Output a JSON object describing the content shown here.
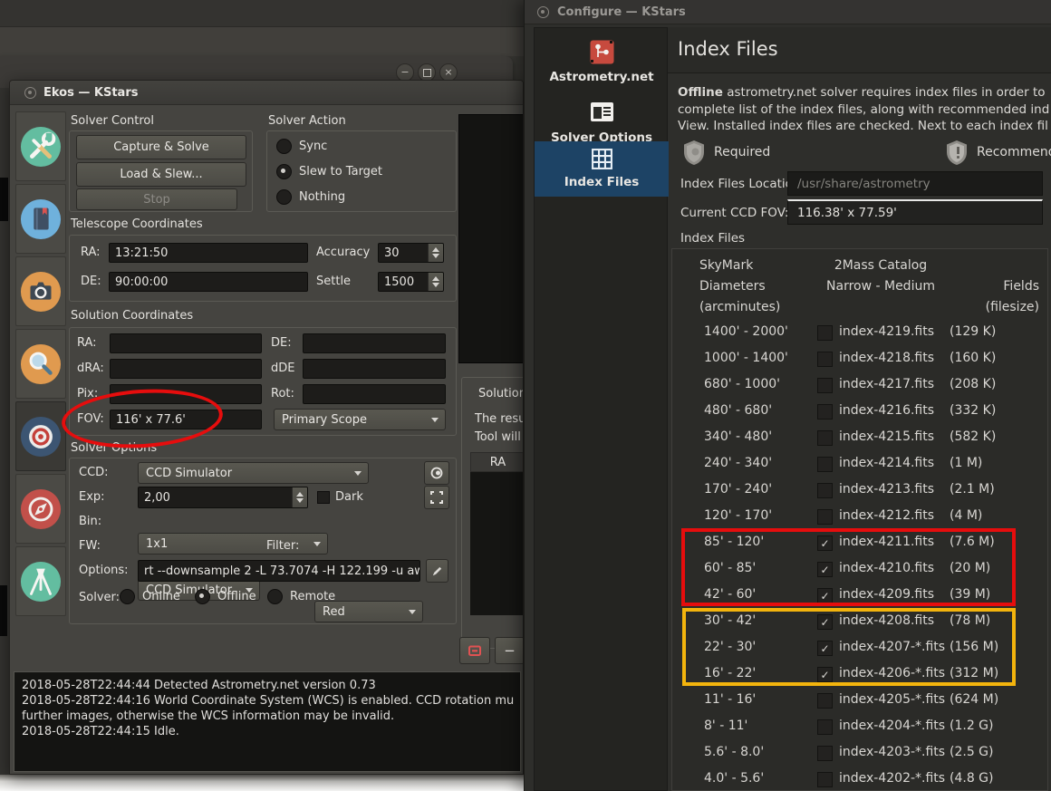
{
  "glyphs": {
    "minimize": "−",
    "close": "×",
    "minus": "−",
    "check": "✓"
  },
  "annotations": {
    "red": "#e60d0d",
    "yellow": "#f3b40d"
  },
  "ekos": {
    "window_title": "Ekos — KStars",
    "modules": [
      "setup-icon",
      "scheduler-icon",
      "capture-icon",
      "focus-icon",
      "align-target-icon",
      "guide-compass-icon",
      "mount-tripod-icon"
    ],
    "solver_control": {
      "title": "Solver Control",
      "capture_solve": "Capture & Solve",
      "load_slew": "Load & Slew...",
      "stop": "Stop"
    },
    "solver_action": {
      "title": "Solver Action",
      "options": [
        {
          "label": "Sync",
          "selected": false
        },
        {
          "label": "Slew to Target",
          "selected": true
        },
        {
          "label": "Nothing",
          "selected": false
        }
      ]
    },
    "telescope_coordinates": {
      "title": "Telescope Coordinates",
      "ra_label": "RA:",
      "ra_value": "13:21:50",
      "de_label": "DE:",
      "de_value": "90:00:00",
      "accuracy_label": "Accuracy",
      "accuracy_value": "30",
      "settle_label": "Settle",
      "settle_value": "1500"
    },
    "solution_coordinates": {
      "title": "Solution Coordinates",
      "ra_label": "RA:",
      "de_label": "DE:",
      "dra_label": "dRA:",
      "dde_label": "dDE",
      "pix_label": "Pix:",
      "rot_label": "Rot:",
      "fov_label": "FOV:",
      "fov_value": "116' x 77.6'",
      "scope_select": "Primary Scope"
    },
    "solver_options_group": {
      "title": "Solver Options",
      "ccd_label": "CCD:",
      "ccd_value": "CCD Simulator",
      "exp_label": "Exp:",
      "exp_value": "2,00",
      "dark_label": "Dark",
      "dark_checked": false,
      "bin_label": "Bin:",
      "bin_value": "1x1",
      "fw_label": "FW:",
      "fw_value": "CCD Simulator",
      "filter_label": "Filter:",
      "filter_value": "Red",
      "options_label": "Options:",
      "options_value": "rt --downsample 2 -L 73.7074 -H 122.199 -u aw",
      "solver_label": "Solver:",
      "solver_modes": [
        {
          "label": "Online",
          "selected": false
        },
        {
          "label": "Offline",
          "selected": true
        },
        {
          "label": "Remote",
          "selected": false
        }
      ]
    },
    "solution_results": {
      "title": "Solution Re",
      "info_line1": "The results",
      "info_line2": "Tool will be",
      "column_ra": "RA"
    },
    "log": [
      "2018-05-28T22:44:44 Detected Astrometry.net version 0.73",
      "2018-05-28T22:44:16 World Coordinate System (WCS) is enabled. CCD rotation mu",
      "further images, otherwise the WCS information may be invalid.",
      "2018-05-28T22:44:15 Idle."
    ]
  },
  "configure": {
    "window_title": "Configure — KStars",
    "sidebar": [
      {
        "label": "Astrometry.net",
        "icon": "astrometry-icon",
        "selected": false
      },
      {
        "label": "Solver Options",
        "icon": "solver-options-icon",
        "selected": false
      },
      {
        "label": "Index Files",
        "icon": "index-files-grid-icon",
        "selected": true
      }
    ],
    "page_title": "Index Files",
    "description": {
      "line1_bold": "Offline",
      "line1_rest": " astrometry.net solver requires index files in order to",
      "line2": "complete list of the index files, along with recommended ind",
      "line3": "View. Installed index files are checked. Next to each index fil"
    },
    "legend": {
      "required": "Required",
      "recommended": "Recommend"
    },
    "location_label": "Index Files Location:",
    "location_value": "/usr/share/astrometry",
    "fov_label": "Current CCD FOV:",
    "fov_value": "116.38' x 77.59'",
    "table_label": "Index Files",
    "table": {
      "header": {
        "col1": [
          "SkyMark",
          "Diameters",
          "(arcminutes)"
        ],
        "col2": [
          "2Mass Catalog",
          "Narrow - Medium"
        ],
        "col3": [
          "Fields",
          "(filesize)"
        ]
      },
      "rows": [
        {
          "range": "1400' - 2000'",
          "checked": false,
          "file": "index-4219.fits",
          "size": "(129 K)"
        },
        {
          "range": "1000' - 1400'",
          "checked": false,
          "file": "index-4218.fits",
          "size": "(160 K)"
        },
        {
          "range": "680' - 1000'",
          "checked": false,
          "file": "index-4217.fits",
          "size": "(208 K)"
        },
        {
          "range": "480' - 680'",
          "checked": false,
          "file": "index-4216.fits",
          "size": "(332 K)"
        },
        {
          "range": "340' - 480'",
          "checked": false,
          "file": "index-4215.fits",
          "size": "(582 K)"
        },
        {
          "range": "240' - 340'",
          "checked": false,
          "file": "index-4214.fits",
          "size": "(1 M)"
        },
        {
          "range": "170' - 240'",
          "checked": false,
          "file": "index-4213.fits",
          "size": "(2.1 M)"
        },
        {
          "range": "120' - 170'",
          "checked": false,
          "file": "index-4212.fits",
          "size": "(4 M)"
        },
        {
          "range": "85' - 120'",
          "checked": true,
          "file": "index-4211.fits",
          "size": "(7.6 M)"
        },
        {
          "range": "60' - 85'",
          "checked": true,
          "file": "index-4210.fits",
          "size": "(20 M)"
        },
        {
          "range": "42' - 60'",
          "checked": true,
          "file": "index-4209.fits",
          "size": "(39 M)"
        },
        {
          "range": "30' - 42'",
          "checked": true,
          "file": "index-4208.fits",
          "size": "(78 M)"
        },
        {
          "range": "22' - 30'",
          "checked": true,
          "file": "index-4207-*.fits",
          "size": "(156 M)"
        },
        {
          "range": "16' - 22'",
          "checked": true,
          "file": "index-4206-*.fits",
          "size": "(312 M)"
        },
        {
          "range": "11' - 16'",
          "checked": false,
          "file": "index-4205-*.fits",
          "size": "(624 M)"
        },
        {
          "range": "8' - 11'",
          "checked": false,
          "file": "index-4204-*.fits",
          "size": "(1.2 G)"
        },
        {
          "range": "5.6' - 8.0'",
          "checked": false,
          "file": "index-4203-*.fits",
          "size": "(2.5 G)"
        },
        {
          "range": "4.0' - 5.6'",
          "checked": false,
          "file": "index-4202-*.fits",
          "size": "(4.8 G)"
        }
      ]
    }
  }
}
